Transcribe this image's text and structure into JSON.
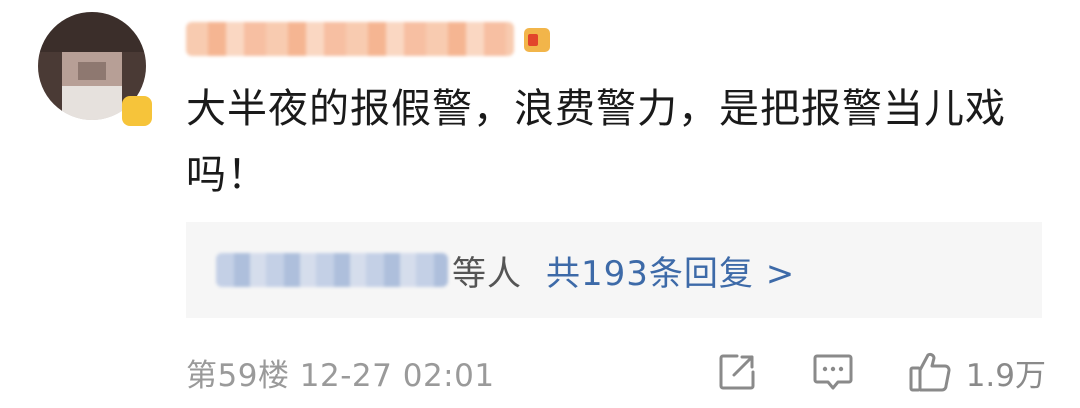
{
  "comment": {
    "text": "大半夜的报假警，浪费警力，是把报警当儿戏吗！"
  },
  "replies": {
    "others_label": "等人",
    "count_label": "共193条回复 >"
  },
  "footer": {
    "floor_time": "第59楼 12-27 02:01",
    "like_count": "1.9万"
  },
  "icons": {
    "share": "share-icon",
    "comment": "comment-icon",
    "like": "thumbs-up-icon"
  },
  "colors": {
    "reply_link": "#3d6aa8",
    "meta_text": "#9a9a9a",
    "reply_bg": "#f6f6f6"
  }
}
